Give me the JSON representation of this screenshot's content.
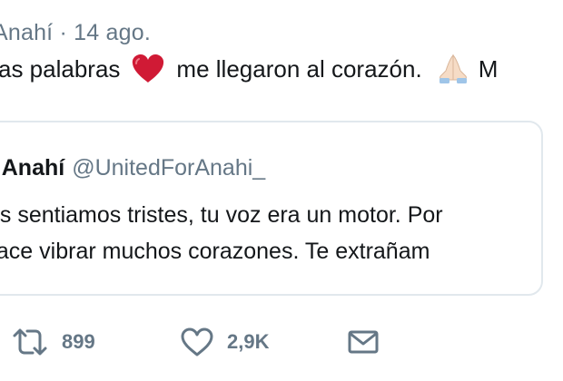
{
  "tweet": {
    "header": "Anahí · 14 ago.",
    "text_before_heart": "as palabras",
    "text_after_heart": "me llegaron al corazón.",
    "text_trailing": "M",
    "emojis": [
      "red-heart-emoji",
      "folded-hands-emoji"
    ]
  },
  "quote": {
    "name": "r Anahí",
    "handle": "@UnitedForAnahi_",
    "line1": "os sentiamos tristes, tu voz era un motor. Por",
    "line2": "hace vibrar muchos corazones. Te extrañam"
  },
  "actions": {
    "retweet_count": "899",
    "like_count": "2,9K",
    "icons": [
      "retweet-icon",
      "heart-outline-icon",
      "envelope-icon"
    ]
  },
  "colors": {
    "text": "#14171a",
    "secondary": "#657786",
    "border": "#e1e8ed",
    "heart": "#d01a35"
  }
}
